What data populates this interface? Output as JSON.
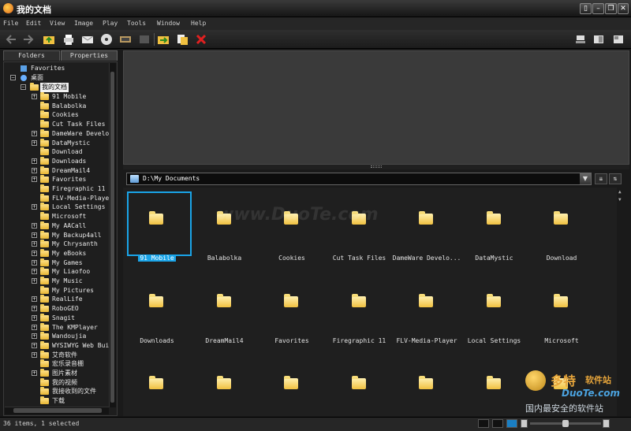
{
  "window": {
    "title": "我的文档"
  },
  "menu": [
    {
      "label": "File",
      "key": "F"
    },
    {
      "label": "Edit",
      "key": "E"
    },
    {
      "label": "View",
      "key": "V"
    },
    {
      "label": "Image",
      "key": "I"
    },
    {
      "label": "Play",
      "key": "P"
    },
    {
      "label": "Tools",
      "key": "T"
    },
    {
      "label": "Window",
      "key": "W"
    },
    {
      "label": "Help",
      "key": "H"
    }
  ],
  "panel_tabs": {
    "folders": "Folders",
    "properties": "Properties"
  },
  "tree": {
    "favorites": "Favorites",
    "desktop": "桌面",
    "my_documents": "我的文档",
    "children": [
      "91 Mobile",
      "Balabolka",
      "Cookies",
      "Cut Task Files",
      "DameWare Develop",
      "DataMystic",
      "Download",
      "Downloads",
      "DreamMail4",
      "Favorites",
      "Firegraphic 11",
      "FLV-Media-Player",
      "Local Settings",
      "Microsoft",
      "My AACall",
      "My Backup4all",
      "My Chrysanth",
      "My eBooks",
      "My Games",
      "My Liaofoo",
      "My Music",
      "My Pictures",
      "RealLife",
      "RoboGEO",
      "Snagit",
      "The KMPlayer",
      "Wandoujia",
      "WYSIWYG Web Buil",
      "艾奇软件",
      "宏乐录音棚",
      "图片素材",
      "我的视频",
      "我接收到的文件",
      "下载"
    ],
    "expandable": [
      true,
      false,
      false,
      false,
      true,
      true,
      false,
      true,
      true,
      true,
      false,
      false,
      true,
      false,
      true,
      true,
      true,
      true,
      true,
      true,
      true,
      false,
      true,
      true,
      true,
      true,
      true,
      true,
      true,
      false,
      true,
      false,
      false,
      false
    ]
  },
  "address": {
    "path": "D:\\My Documents"
  },
  "files": [
    "91 Mobile",
    "Balabolka",
    "Cookies",
    "Cut Task Files",
    "DameWare Develo...",
    "DataMystic",
    "Download",
    "Downloads",
    "DreamMail4",
    "Favorites",
    "Firegraphic 11",
    "FLV-Media-Player",
    "Local Settings",
    "Microsoft",
    "",
    "",
    "",
    "",
    "",
    "",
    ""
  ],
  "selected_file": "91 Mobile",
  "watermark": "www.DuoTe.com",
  "brand": {
    "line1": "多特",
    "line2": "软件站",
    "site": "DuoTe.com",
    "slogan": "国内最安全的软件站"
  },
  "status": {
    "text": "36 items, 1 selected"
  },
  "colors": {
    "accent": "#1aa4e8",
    "background": "#1f1f1f"
  }
}
